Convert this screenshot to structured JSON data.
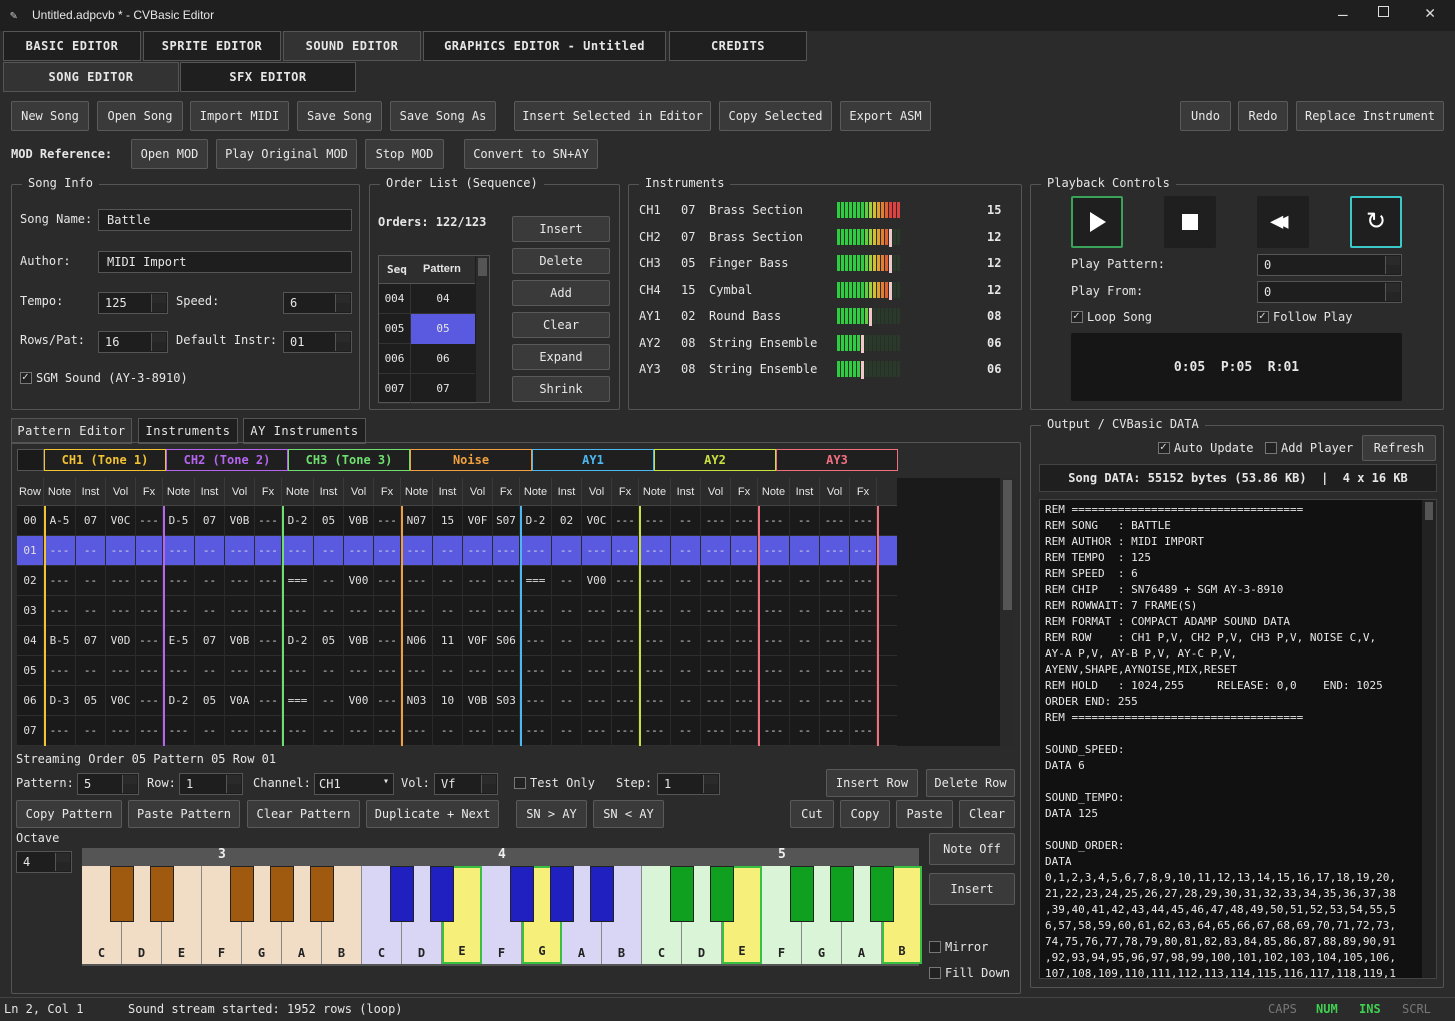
{
  "window": {
    "title": "Untitled.adpcvb * - CVBasic Editor"
  },
  "main_tabs": [
    "BASIC EDITOR",
    "SPRITE EDITOR",
    "SOUND EDITOR",
    "GRAPHICS EDITOR - Untitled",
    "CREDITS"
  ],
  "sub_tabs": [
    "SONG EDITOR",
    "SFX EDITOR"
  ],
  "toolbar": {
    "new_song": "New Song",
    "open_song": "Open Song",
    "import_midi": "Import MIDI",
    "save_song": "Save Song",
    "save_song_as": "Save Song As",
    "insert_selected": "Insert Selected in Editor",
    "copy_selected": "Copy Selected",
    "export_asm": "Export ASM",
    "undo": "Undo",
    "redo": "Redo",
    "replace_instrument": "Replace Instrument"
  },
  "mod": {
    "label": "MOD Reference:",
    "open": "Open MOD",
    "play": "Play Original MOD",
    "stop": "Stop MOD",
    "convert": "Convert to SN+AY"
  },
  "song_info": {
    "title": "Song Info",
    "name_label": "Song Name:",
    "name": "Battle",
    "author_label": "Author:",
    "author": "MIDI Import",
    "tempo_label": "Tempo:",
    "tempo": "125",
    "speed_label": "Speed:",
    "speed": "6",
    "rows_label": "Rows/Pat:",
    "rows": "16",
    "instr_label": "Default Instr:",
    "instr": "01",
    "sgm_label": "SGM Sound (AY-3-8910)"
  },
  "order_list": {
    "title": "Order List (Sequence)",
    "orders_label": "Orders: 122/123",
    "col_seq": "Seq",
    "col_pattern": "Pattern",
    "rows": [
      [
        "004",
        "04"
      ],
      [
        "005",
        "05"
      ],
      [
        "006",
        "06"
      ],
      [
        "007",
        "07"
      ]
    ],
    "buttons": [
      "Insert",
      "Delete",
      "Add",
      "Clear",
      "Expand",
      "Shrink"
    ]
  },
  "instruments": {
    "title": "Instruments",
    "rows": [
      {
        "ch": "CH1",
        "num": "07",
        "name": "Brass Section",
        "vol": "15",
        "level": 1.0
      },
      {
        "ch": "CH2",
        "num": "07",
        "name": "Brass Section",
        "vol": "12",
        "level": 0.8
      },
      {
        "ch": "CH3",
        "num": "05",
        "name": "Finger Bass",
        "vol": "12",
        "level": 0.8
      },
      {
        "ch": "CH4",
        "num": "15",
        "name": "Cymbal",
        "vol": "12",
        "level": 0.8
      },
      {
        "ch": "AY1",
        "num": "02",
        "name": "Round Bass",
        "vol": "08",
        "level": 0.5
      },
      {
        "ch": "AY2",
        "num": "08",
        "name": "String Ensemble",
        "vol": "06",
        "level": 0.4
      },
      {
        "ch": "AY3",
        "num": "08",
        "name": "String Ensemble",
        "vol": "06",
        "level": 0.4
      }
    ]
  },
  "playback": {
    "title": "Playback Controls",
    "play_pattern_label": "Play Pattern:",
    "play_pattern": "0",
    "play_from_label": "Play From:",
    "play_from": "0",
    "loop_label": "Loop Song",
    "follow_label": "Follow Play",
    "status": "0:05  P:05  R:01"
  },
  "pattern_tabs": [
    "Pattern Editor",
    "Instruments",
    "AY Instruments"
  ],
  "channels": [
    {
      "name": "CH1 (Tone 1)",
      "color": "#f1c232"
    },
    {
      "name": "CH2 (Tone 2)",
      "color": "#b565f0"
    },
    {
      "name": "CH3 (Tone 3)",
      "color": "#6fe06f"
    },
    {
      "name": "Noise",
      "color": "#f0a040"
    },
    {
      "name": "AY1",
      "color": "#4db8f0"
    },
    {
      "name": "AY2",
      "color": "#c8e040"
    },
    {
      "name": "AY3",
      "color": "#f07080"
    }
  ],
  "grid_headers": [
    "Row",
    "Note",
    "Inst",
    "Vol",
    "Fx"
  ],
  "grid_rows": [
    [
      "00",
      "A-5",
      "07",
      "V0C",
      "---",
      "D-5",
      "07",
      "V0B",
      "---",
      "D-2",
      "05",
      "V0B",
      "---",
      "N07",
      "15",
      "V0F",
      "S07",
      "D-2",
      "02",
      "V0C",
      "---",
      "---",
      "--",
      "---",
      "---",
      "---",
      "--",
      "---",
      "---"
    ],
    [
      "01",
      "---",
      "--",
      "---",
      "---",
      "---",
      "--",
      "---",
      "---",
      "---",
      "--",
      "---",
      "---",
      "---",
      "--",
      "---",
      "---",
      "---",
      "--",
      "---",
      "---",
      "---",
      "--",
      "---",
      "---",
      "---",
      "--",
      "---",
      "---"
    ],
    [
      "02",
      "---",
      "--",
      "---",
      "---",
      "---",
      "--",
      "---",
      "---",
      "===",
      "--",
      "V00",
      "---",
      "---",
      "--",
      "---",
      "---",
      "===",
      "--",
      "V00",
      "---",
      "---",
      "--",
      "---",
      "---",
      "---",
      "--",
      "---",
      "---"
    ],
    [
      "03",
      "---",
      "--",
      "---",
      "---",
      "---",
      "--",
      "---",
      "---",
      "---",
      "--",
      "---",
      "---",
      "---",
      "--",
      "---",
      "---",
      "---",
      "--",
      "---",
      "---",
      "---",
      "--",
      "---",
      "---",
      "---",
      "--",
      "---",
      "---"
    ],
    [
      "04",
      "B-5",
      "07",
      "V0D",
      "---",
      "E-5",
      "07",
      "V0B",
      "---",
      "D-2",
      "05",
      "V0B",
      "---",
      "N06",
      "11",
      "V0F",
      "S06",
      "---",
      "--",
      "---",
      "---",
      "---",
      "--",
      "---",
      "---",
      "---",
      "--",
      "---",
      "---"
    ],
    [
      "05",
      "---",
      "--",
      "---",
      "---",
      "---",
      "--",
      "---",
      "---",
      "---",
      "--",
      "---",
      "---",
      "---",
      "--",
      "---",
      "---",
      "---",
      "--",
      "---",
      "---",
      "---",
      "--",
      "---",
      "---",
      "---",
      "--",
      "---",
      "---"
    ],
    [
      "06",
      "D-3",
      "05",
      "V0C",
      "---",
      "D-2",
      "05",
      "V0A",
      "---",
      "===",
      "--",
      "V00",
      "---",
      "N03",
      "10",
      "V0B",
      "S03",
      "---",
      "--",
      "---",
      "---",
      "---",
      "--",
      "---",
      "---",
      "---",
      "--",
      "---",
      "---"
    ],
    [
      "07",
      "---",
      "--",
      "---",
      "---",
      "---",
      "--",
      "---",
      "---",
      "---",
      "--",
      "---",
      "---",
      "---",
      "--",
      "---",
      "---",
      "---",
      "--",
      "---",
      "---",
      "---",
      "--",
      "---",
      "---",
      "---",
      "--",
      "---",
      "---"
    ]
  ],
  "streaming": "Streaming Order 05 Pattern 05 Row 01",
  "edit": {
    "pattern_label": "Pattern:",
    "pattern": "5",
    "row_label": "Row:",
    "row": "1",
    "channel_label": "Channel:",
    "channel": "CH1",
    "vol_label": "Vol:",
    "vol": "Vf",
    "test_label": "Test Only",
    "step_label": "Step:",
    "step": "1",
    "insert_row": "Insert Row",
    "delete_row": "Delete Row",
    "copy_pattern": "Copy Pattern",
    "paste_pattern": "Paste Pattern",
    "clear_pattern": "Clear Pattern",
    "dup_next": "Duplicate + Next",
    "sn_ay": "SN > AY",
    "ay_sn": "SN < AY",
    "cut": "Cut",
    "copy": "Copy",
    "paste": "Paste",
    "clear": "Clear"
  },
  "octave": {
    "label": "Octave",
    "value": "4",
    "marks": [
      "3",
      "4",
      "5"
    ]
  },
  "keys": [
    "C",
    "D",
    "E",
    "F",
    "G",
    "A",
    "B",
    "C",
    "D",
    "E",
    "F",
    "G",
    "A",
    "B",
    "C",
    "D",
    "E",
    "F",
    "G",
    "A",
    "B"
  ],
  "piano_side": {
    "note_off": "Note Off",
    "insert": "Insert",
    "mirror": "Mirror",
    "fill_down": "Fill Down"
  },
  "output": {
    "title": "Output / CVBasic DATA",
    "auto_update": "Auto Update",
    "add_player": "Add Player",
    "refresh": "Refresh",
    "summary": "Song DATA: 55152 bytes (53.86 KB)  |  4 x 16 KB",
    "code": "REM ===================================\nREM SONG   : BATTLE\nREM AUTHOR : MIDI IMPORT\nREM TEMPO  : 125\nREM SPEED  : 6\nREM CHIP   : SN76489 + SGM AY-3-8910\nREM ROWWAIT: 7 FRAME(S)\nREM FORMAT : COMPACT ADAMP SOUND DATA\nREM ROW    : CH1 P,V, CH2 P,V, CH3 P,V, NOISE C,V,\nAY-A P,V, AY-B P,V, AY-C P,V,\nAYENV,SHAPE,AYNOISE,MIX,RESET\nREM HOLD   : 1024,255     RELEASE: 0,0    END: 1025\nORDER END: 255\nREM ===================================\n\nSOUND_SPEED:\nDATA 6\n\nSOUND_TEMPO:\nDATA 125\n\nSOUND_ORDER:\nDATA\n0,1,2,3,4,5,6,7,8,9,10,11,12,13,14,15,16,17,18,19,20,\n21,22,23,24,25,26,27,28,29,30,31,32,33,34,35,36,37,38\n,39,40,41,42,43,44,45,46,47,48,49,50,51,52,53,54,55,5\n6,57,58,59,60,61,62,63,64,65,66,67,68,69,70,71,72,73,\n74,75,76,77,78,79,80,81,82,83,84,85,86,87,88,89,90,91\n,92,93,94,95,96,97,98,99,100,101,102,103,104,105,106,\n107,108,109,110,111,112,113,114,115,116,117,118,119,1"
  },
  "statusbar": {
    "pos": "Ln 2, Col 1",
    "msg": "Sound stream started: 1952 rows (loop)",
    "caps": "CAPS",
    "num": "NUM",
    "ins": "INS",
    "scrl": "SCRL"
  }
}
